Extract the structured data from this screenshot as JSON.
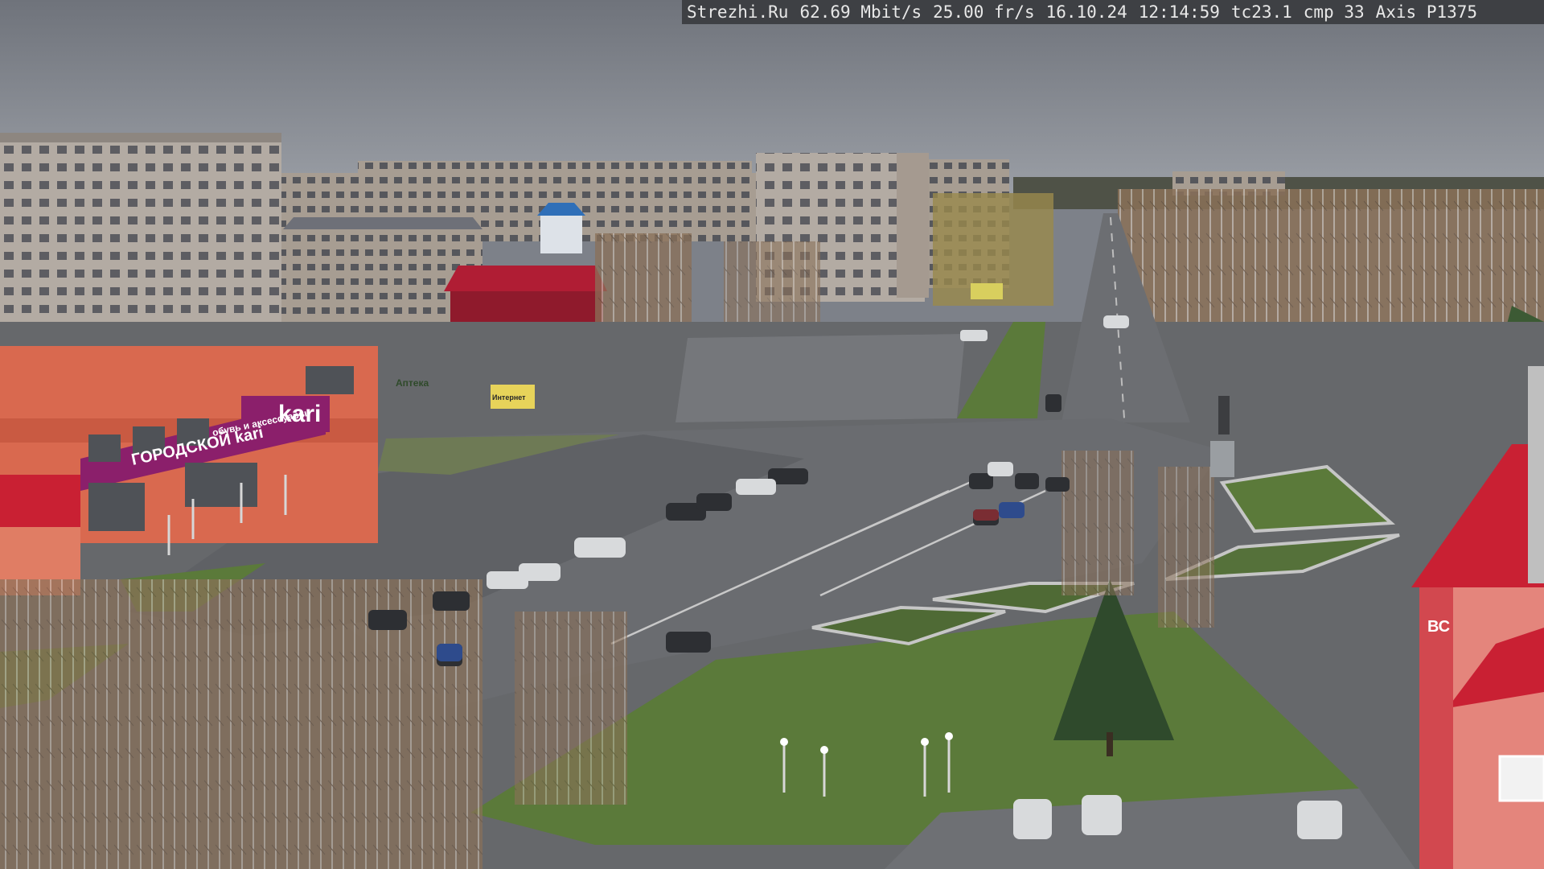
{
  "overlay": {
    "site": "Strezhi.Ru",
    "bitrate": "62.69 Mbit/s",
    "framerate": "25.00 fr/s",
    "date": "16.10.24",
    "time": "12:14:59",
    "tc": "tc23.1",
    "cmp": "cmp 33",
    "camera_model": "Axis P1375"
  },
  "signs": {
    "store_logo": "kari",
    "store_banner": "ГОРОДСКОЙ kari",
    "store_banner_small": "обувь и аксессуары",
    "shop_sign": "Аптека",
    "billboard": "Интернет",
    "tower_letters": "ВС"
  },
  "colors": {
    "sky": "#7e828a",
    "kari_purple": "#8b1f6b",
    "roof_red": "#b01d34",
    "grass": "#5b7a3a",
    "asphalt": "#6c6e72"
  }
}
